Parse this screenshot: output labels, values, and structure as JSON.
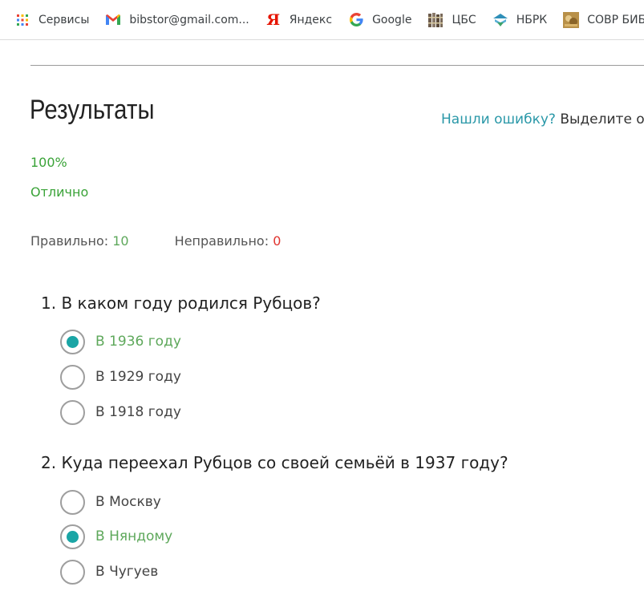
{
  "bookmarks": [
    {
      "label": "Сервисы",
      "icon": "apps-grid-icon"
    },
    {
      "label": "bibstor@gmail.com...",
      "icon": "gmail-icon"
    },
    {
      "label": "Яндекс",
      "icon": "yandex-icon",
      "glyph": "Я"
    },
    {
      "label": "Google",
      "icon": "google-icon"
    },
    {
      "label": "ЦБС",
      "icon": "books-icon"
    },
    {
      "label": "НБРК",
      "icon": "library-icon"
    },
    {
      "label": "СОВР БИБ",
      "icon": "photo-favicon"
    }
  ],
  "results": {
    "title": "Результаты",
    "report_link": "Нашли ошибку?",
    "report_text": " Выделите оши",
    "percent": "100%",
    "grade": "Отлично",
    "correct_label": "Правильно:",
    "correct_count": "10",
    "wrong_label": "Неправильно:",
    "wrong_count": "0"
  },
  "questions": [
    {
      "text": "1. В каком году родился Рубцов?",
      "answers": [
        {
          "label": "В 1936 году",
          "selected": true
        },
        {
          "label": "В 1929 году",
          "selected": false
        },
        {
          "label": "В 1918 году",
          "selected": false
        }
      ]
    },
    {
      "text": "2. Куда переехал Рубцов со своей семьёй в 1937 году?",
      "answers": [
        {
          "label": "В Москву",
          "selected": false
        },
        {
          "label": "В Няндому",
          "selected": true
        },
        {
          "label": "В Чугуев",
          "selected": false
        }
      ]
    }
  ],
  "colors": {
    "correct_green": "#5ea85b",
    "grade_green": "#3aa338",
    "link_teal": "#2a98a8",
    "radio_teal": "#1aa5a5",
    "error_red": "#e0342f"
  }
}
